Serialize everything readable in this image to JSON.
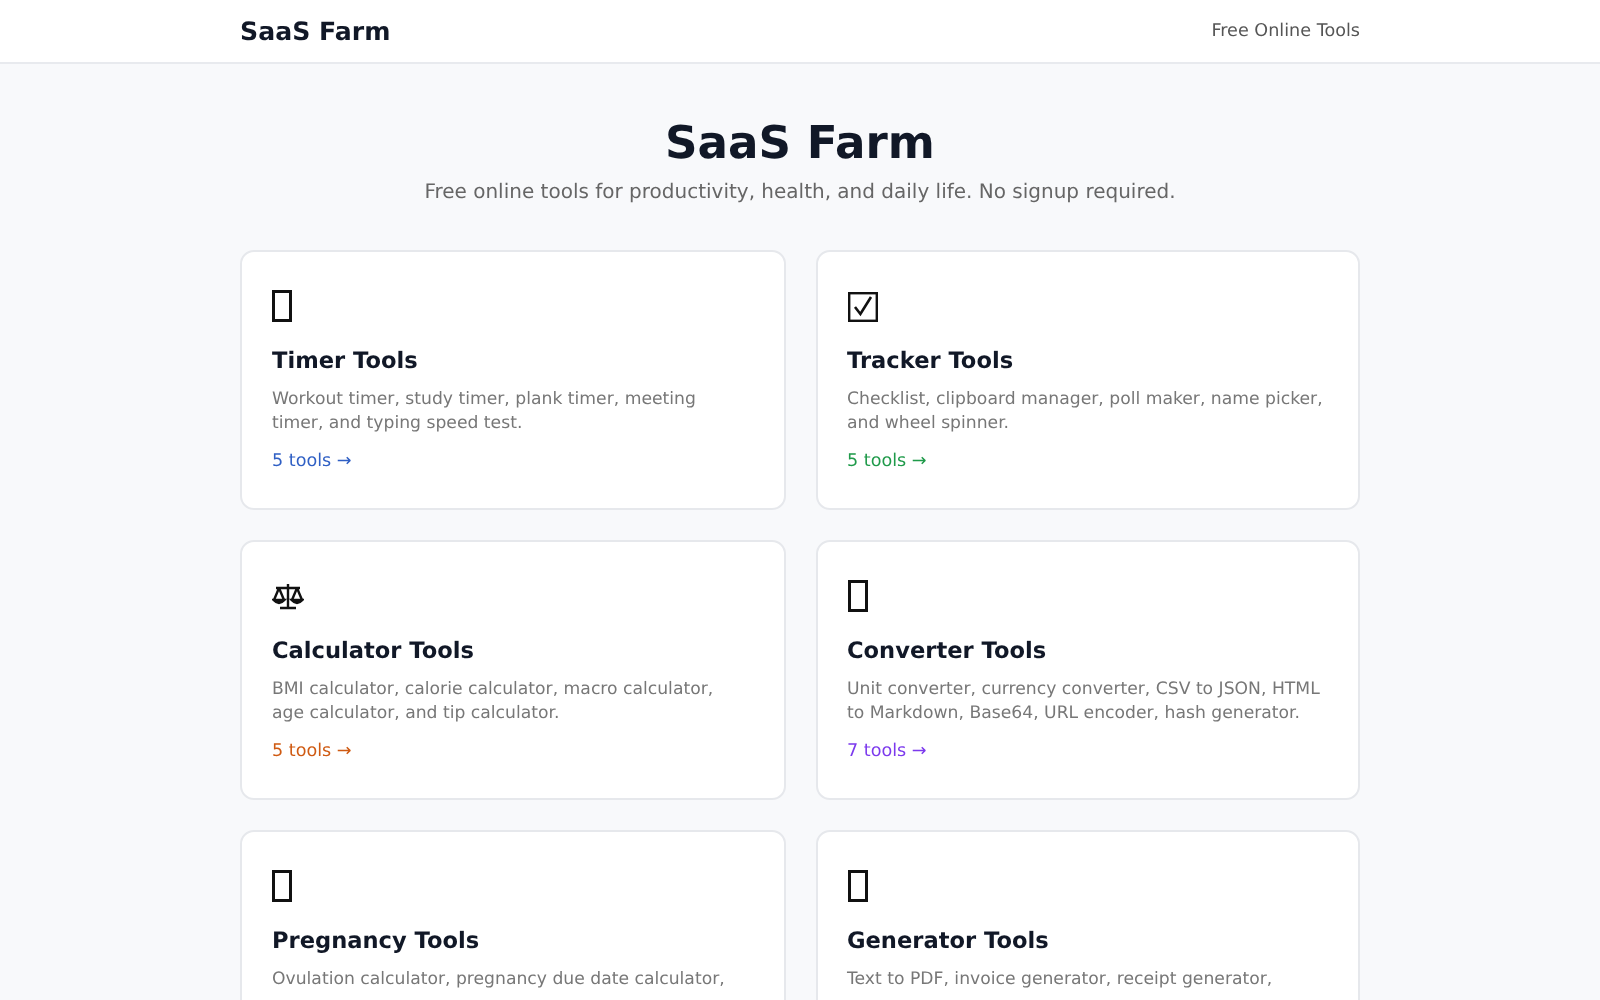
{
  "header": {
    "brand": "SaaS Farm",
    "nav_link": "Free Online Tools"
  },
  "hero": {
    "title": "SaaS Farm",
    "subtitle": "Free online tools for productivity, health, and daily life. No signup required."
  },
  "cards": [
    {
      "icon": {
        "kind": "box"
      },
      "title": "Timer Tools",
      "description": "Workout timer, study timer, plank timer, meeting timer, and typing speed test.",
      "link": "5 tools →",
      "color": "#2f5fc4"
    },
    {
      "icon": {
        "kind": "check"
      },
      "title": "Tracker Tools",
      "description": "Checklist, clipboard manager, poll maker, name picker, and wheel spinner.",
      "link": "5 tools →",
      "color": "#1f9a4a"
    },
    {
      "icon": {
        "kind": "scales"
      },
      "title": "Calculator Tools",
      "description": "BMI calculator, calorie calculator, macro calculator, age calculator, and tip calculator.",
      "link": "5 tools →",
      "color": "#cf5a12"
    },
    {
      "icon": {
        "kind": "box"
      },
      "title": "Converter Tools",
      "description": "Unit converter, currency converter, CSV to JSON, HTML to Markdown, Base64, URL encoder, hash generator.",
      "link": "7 tools →",
      "color": "#7c3aed"
    },
    {
      "icon": {
        "kind": "box"
      },
      "title": "Pregnancy Tools",
      "description": "Ovulation calculator, pregnancy due date calculator,"
    },
    {
      "icon": {
        "kind": "box"
      },
      "title": "Generator Tools",
      "description": "Text to PDF, invoice generator, receipt generator,"
    }
  ]
}
